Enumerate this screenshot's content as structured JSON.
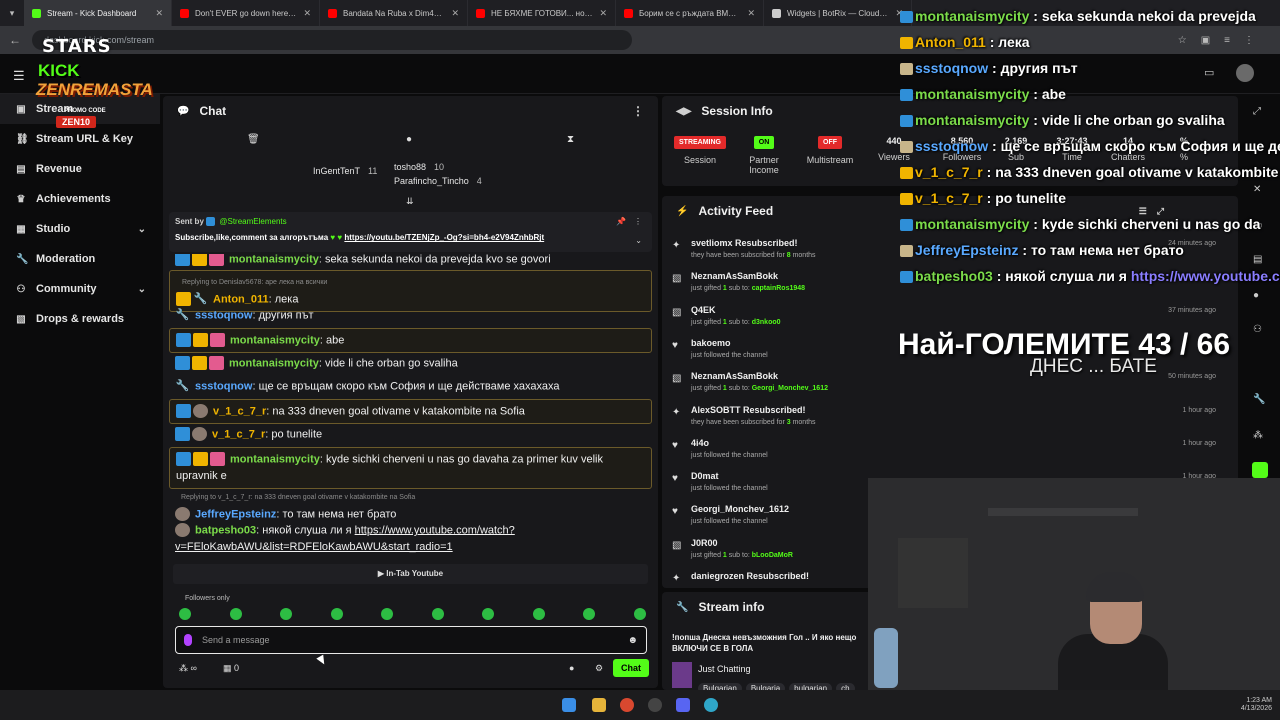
{
  "browser": {
    "tabs": [
      {
        "title": "Stream - Kick Dashboard",
        "color": "#53fc18",
        "active": true
      },
      {
        "title": "Don't EVER go down here...(Pa",
        "color": "#ff0000"
      },
      {
        "title": "Bandata Na Ruba x Dim4ou - Ji",
        "color": "#ff0000"
      },
      {
        "title": "НЕ БЯХМЕ ГОТОВИ... но тръгн",
        "color": "#ff0000"
      },
      {
        "title": "Борим се с ръждата BMW e34",
        "color": "#ff0000"
      },
      {
        "title": "Widgets | BotRix — Cloud Stre",
        "color": "#cccccc"
      }
    ],
    "url": "dashboard.kick.com/stream"
  },
  "logo": {
    "stars": "STARS",
    "kick": "KICK",
    "zen": "ZENREMASTA",
    "promo": "PROMO CODE",
    "code": "ZEN10"
  },
  "sidebar": {
    "items": [
      {
        "label": "Stream",
        "icon": "video-icon"
      },
      {
        "label": "Stream URL & Key",
        "icon": "link-icon"
      },
      {
        "label": "Revenue",
        "icon": "revenue-icon"
      },
      {
        "label": "Achievements",
        "icon": "trophy-icon"
      },
      {
        "label": "Studio",
        "icon": "studio-icon"
      },
      {
        "label": "Moderation",
        "icon": "wrench-icon"
      },
      {
        "label": "Community",
        "icon": "users-icon"
      },
      {
        "label": "Drops & rewards",
        "icon": "gift-icon"
      }
    ]
  },
  "chat": {
    "title": "Chat",
    "leaderboard": [
      {
        "name": "InGentTenT",
        "value": "11"
      },
      {
        "name": "tosho88",
        "value": "10"
      },
      {
        "name": "Parafincho_Tincho",
        "value": "4"
      }
    ],
    "pinned": {
      "sent_by": "Sent by",
      "sender": "@StreamElements",
      "text": "Subscribe,like,comment за алгорътъма",
      "link": "https://youtu.be/TZENjZp_-Og?si=bh4-e2V94ZnhbRjt"
    },
    "messages": [
      {
        "user": "montanaismycity",
        "color": "#7bdb4a",
        "text": "seka sekunda nekoi da prevejda kvo se govori",
        "cut": true
      },
      {
        "reply": "Replying to Denislav5678: аре лека на всички",
        "user": "Anton_011",
        "color": "#f0b400",
        "text": "лека",
        "highlight": true
      },
      {
        "user": "ssstoqnow",
        "color": "#5aa9ff",
        "text": "другия път"
      },
      {
        "user": "montanaismycity",
        "color": "#7bdb4a",
        "text": "abe",
        "highlight": true
      },
      {
        "user": "montanaismycity",
        "color": "#7bdb4a",
        "text": "vide li che orban go svaliha"
      },
      {
        "user": "ssstoqnow",
        "color": "#5aa9ff",
        "text": "ще се връщам скоро към София и ще действаме хахахаха"
      },
      {
        "user": "v_1_c_7_r",
        "color": "#f0b400",
        "text": "na 333 dneven goal otivame v katakombite na Sofia",
        "highlight": true
      },
      {
        "user": "v_1_c_7_r",
        "color": "#f0b400",
        "text": "po tunelite"
      },
      {
        "user": "montanaismycity",
        "color": "#7bdb4a",
        "text": "kyde sichki cherveni u nas go davaha za primer kuv velik upravnik e",
        "highlight": true
      },
      {
        "reply": "Replying to v_1_c_7_r: na 333 dneven goal otivame v katakombite na Sofia",
        "user": "JeffreyEpsteinz",
        "color": "#5aa9ff",
        "text": "то там нема нет брато"
      },
      {
        "user": "batpesho03",
        "color": "#7bdb4a",
        "text": "някой слуша ли я",
        "link": "https://www.youtube.com/watch?v=FEloKawbAWU&list=RDFEloKawbAWU&start_radio=1"
      }
    ],
    "in_tab": "In-Tab Youtube",
    "followers_only": "Followers only",
    "input_placeholder": "Send a message",
    "footer_count": "0",
    "send_label": "Chat"
  },
  "session": {
    "title": "Session Info",
    "stats": [
      {
        "pill": "STREAMING",
        "label": "Session"
      },
      {
        "pill": "ON",
        "label": "Partner Income"
      },
      {
        "pill": "OFF",
        "label": "Multistream"
      },
      {
        "value": "440",
        "label": "Viewers"
      },
      {
        "value": "8,560",
        "label": "Followers"
      },
      {
        "value": "2,169",
        "label": "Sub"
      },
      {
        "value": "3:27:43",
        "label": "Time"
      },
      {
        "value": "14",
        "label": "Chatters"
      },
      {
        "value": "%",
        "label": "%"
      }
    ]
  },
  "activity": {
    "title": "Activity Feed",
    "items": [
      {
        "name": "svetliomx Resubscribed!",
        "desc_pre": "they have been subscribed for ",
        "bold": "8",
        "desc_post": " months",
        "time": "24 minutes ago",
        "icon": "star-icon"
      },
      {
        "name": "NeznamAsSamBokk",
        "desc_pre": "just gifted ",
        "bold": "1",
        "desc_post": " sub to: ",
        "target": "captainRos1948",
        "time": "",
        "icon": "gift-icon"
      },
      {
        "name": "Q4EK",
        "desc_pre": "just gifted ",
        "bold": "1",
        "desc_post": " sub to: ",
        "target": "d3nkoo0",
        "time": "37 minutes ago",
        "icon": "gift-icon"
      },
      {
        "name": "bakoemo",
        "desc_pre": "just followed the channel",
        "time": "",
        "icon": "heart-icon"
      },
      {
        "name": "NeznamAsSamBokk",
        "desc_pre": "just gifted ",
        "bold": "1",
        "desc_post": " sub to: ",
        "target": "Georgi_Monchev_1612",
        "time": "50 minutes ago",
        "icon": "gift-icon"
      },
      {
        "name": "AlexSOBTT Resubscribed!",
        "desc_pre": "they have been subscribed for ",
        "bold": "3",
        "desc_post": " months",
        "time": "1 hour ago",
        "icon": "star-icon"
      },
      {
        "name": "4i4o",
        "desc_pre": "just followed the channel",
        "time": "1 hour ago",
        "icon": "heart-icon"
      },
      {
        "name": "D0mat",
        "desc_pre": "just followed the channel",
        "time": "1 hour ago",
        "icon": "heart-icon"
      },
      {
        "name": "Georgi_Monchev_1612",
        "desc_pre": "just followed the channel",
        "time": "",
        "icon": "heart-icon"
      },
      {
        "name": "J0R00",
        "desc_pre": "just gifted ",
        "bold": "1",
        "desc_post": " sub to: ",
        "target": "bLooDaMoR",
        "time": "",
        "icon": "gift-icon"
      },
      {
        "name": "daniegrozen Resubscribed!",
        "time": "",
        "icon": "star-icon"
      }
    ]
  },
  "stream_info": {
    "title": "Stream info",
    "stream_title": "!попша Днеска невъзможния Гол .. И яко нещо ВКЛЮЧИ СЕ В ГОЛА",
    "category": "Just Chatting",
    "tags": [
      "Bulgarian",
      "Bulgaria",
      "bulgarian",
      "ch"
    ]
  },
  "overlay": {
    "chat": [
      {
        "user": "montanaismycity",
        "color": "#7bdb4a",
        "text": "seka sekunda nekoi da prevejda"
      },
      {
        "user": "Anton_011",
        "color": "#f0b400",
        "text": "лека"
      },
      {
        "user": "ssstoqnow",
        "color": "#5aa9ff",
        "text": "другия път"
      },
      {
        "user": "montanaismycity",
        "color": "#7bdb4a",
        "text": "abe"
      },
      {
        "user": "montanaismycity",
        "color": "#7bdb4a",
        "text": "vide li che orban go svaliha"
      },
      {
        "user": "ssstoqnow",
        "color": "#5aa9ff",
        "text": "ще се връщам скоро към София и ще дей"
      },
      {
        "user": "v_1_c_7_r",
        "color": "#f0b400",
        "text": "na 333 dneven goal otivame v katakombite"
      },
      {
        "user": "v_1_c_7_r",
        "color": "#f0b400",
        "text": "po tunelite"
      },
      {
        "user": "montanaismycity",
        "color": "#7bdb4a",
        "text": "kyde sichki cherveni u nas go da"
      },
      {
        "user": "JeffreyEpsteinz",
        "color": "#5aa9ff",
        "text": "то там нема нет брато"
      },
      {
        "user": "batpesho03",
        "color": "#7bdb4a",
        "text": "някой слуша ли я",
        "link": "https://www.youtube.co"
      }
    ],
    "goal": "Най-ГОЛЕМИТЕ 43 / 66",
    "goal_sub": "ДНЕС ... БАТЕ"
  },
  "taskbar": {
    "time": "1:23 AM",
    "date": "4/13/2026"
  }
}
